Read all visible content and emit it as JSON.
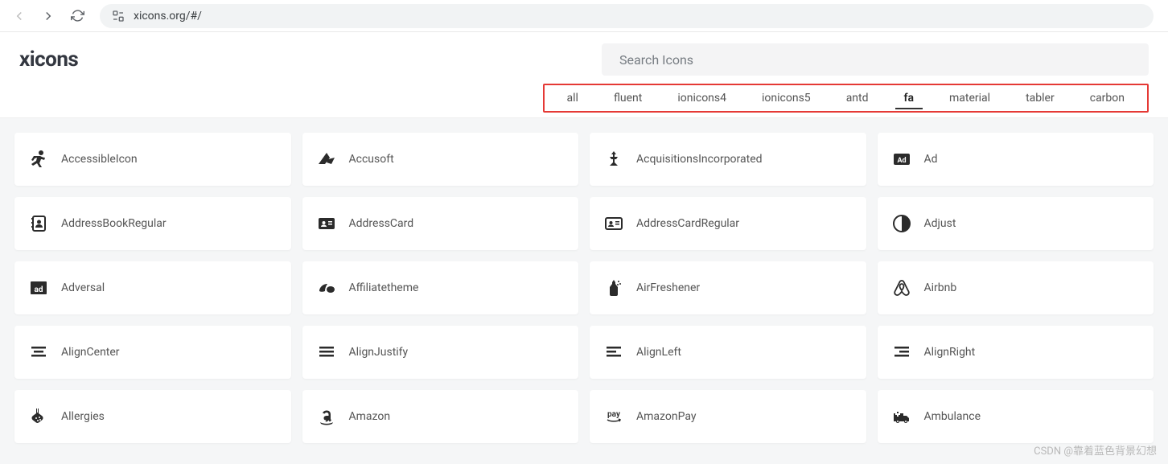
{
  "browser": {
    "url": "xicons.org/#/"
  },
  "header": {
    "logo": "xicons",
    "search_placeholder": "Search Icons"
  },
  "tabs": [
    {
      "label": "all",
      "active": false
    },
    {
      "label": "fluent",
      "active": false
    },
    {
      "label": "ionicons4",
      "active": false
    },
    {
      "label": "ionicons5",
      "active": false
    },
    {
      "label": "antd",
      "active": false
    },
    {
      "label": "fa",
      "active": true
    },
    {
      "label": "material",
      "active": false
    },
    {
      "label": "tabler",
      "active": false
    },
    {
      "label": "carbon",
      "active": false
    }
  ],
  "icons": [
    {
      "name": "AccessibleIcon",
      "icon": "accessible"
    },
    {
      "name": "Accusoft",
      "icon": "accusoft"
    },
    {
      "name": "AcquisitionsIncorporated",
      "icon": "acquisitions"
    },
    {
      "name": "Ad",
      "icon": "ad"
    },
    {
      "name": "AddressBookRegular",
      "icon": "addressbook-reg"
    },
    {
      "name": "AddressCard",
      "icon": "addresscard"
    },
    {
      "name": "AddressCardRegular",
      "icon": "addresscard-reg"
    },
    {
      "name": "Adjust",
      "icon": "adjust"
    },
    {
      "name": "Adversal",
      "icon": "adversal"
    },
    {
      "name": "Affiliatetheme",
      "icon": "affiliatetheme"
    },
    {
      "name": "AirFreshener",
      "icon": "airfreshener"
    },
    {
      "name": "Airbnb",
      "icon": "airbnb"
    },
    {
      "name": "AlignCenter",
      "icon": "aligncenter"
    },
    {
      "name": "AlignJustify",
      "icon": "alignjustify"
    },
    {
      "name": "AlignLeft",
      "icon": "alignleft"
    },
    {
      "name": "AlignRight",
      "icon": "alignright"
    },
    {
      "name": "Allergies",
      "icon": "allergies"
    },
    {
      "name": "Amazon",
      "icon": "amazon"
    },
    {
      "name": "AmazonPay",
      "icon": "amazonpay"
    },
    {
      "name": "Ambulance",
      "icon": "ambulance"
    }
  ],
  "watermark": "CSDN @靠着蓝色背景幻想"
}
